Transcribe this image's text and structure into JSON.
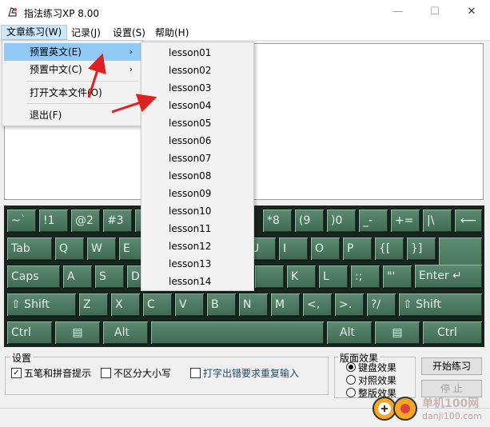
{
  "window": {
    "title": "指法练习XP 8.00",
    "minimize": "—",
    "maximize": "☐",
    "close": "✕"
  },
  "menubar": [
    "文章练习(W)",
    "记录(J)",
    "设置(S)",
    "帮助(H)"
  ],
  "article_menu": {
    "items": [
      "预置英文(E)",
      "预置中文(C)",
      "打开文本文件(O)",
      "退出(F)"
    ],
    "arrow": "›"
  },
  "lesson_submenu": [
    "lesson01",
    "lesson02",
    "lesson03",
    "lesson04",
    "lesson05",
    "lesson06",
    "lesson07",
    "lesson08",
    "lesson09",
    "lesson10",
    "lesson11",
    "lesson12",
    "lesson13",
    "lesson14"
  ],
  "keyboard": {
    "row1": [
      "~`",
      "!1",
      "@2",
      "#3",
      "",
      "",
      "",
      "",
      "*8",
      "(9",
      ")0",
      "_-",
      "+=",
      "|\\",
      "⟵"
    ],
    "row2": [
      "Tab",
      "Q",
      "W",
      "E",
      "",
      "",
      "",
      "U",
      "I",
      "O",
      "P",
      "{[",
      "}]"
    ],
    "row3": [
      "Caps",
      "A",
      "S",
      "D",
      "",
      "",
      "",
      "",
      "K",
      "L",
      ":;",
      "\"'",
      "Enter ↵"
    ],
    "row4": [
      "⇧ Shift",
      "Z",
      "X",
      "C",
      "V",
      "B",
      "N",
      "M",
      "<,",
      ">.",
      "?/",
      "⇧ Shift"
    ],
    "row5": [
      "Ctrl",
      "▤",
      "Alt",
      "",
      "Alt",
      "▤",
      "Ctrl"
    ]
  },
  "settings": {
    "title": "设置",
    "options": [
      {
        "label": "五笔和拼音提示",
        "checked": true
      },
      {
        "label": "不区分大小写",
        "checked": false
      },
      {
        "label": "打字出错要求重复输入",
        "checked": false
      }
    ]
  },
  "layout": {
    "title": "版面效果",
    "options": [
      {
        "label": "键盘效果",
        "selected": true
      },
      {
        "label": "对照效果",
        "selected": false
      },
      {
        "label": "整版效果",
        "selected": false
      }
    ]
  },
  "buttons": {
    "start": "开始练习",
    "stop": "停 止"
  },
  "watermark": {
    "brand": "单机100网",
    "url": "danji100.com"
  }
}
